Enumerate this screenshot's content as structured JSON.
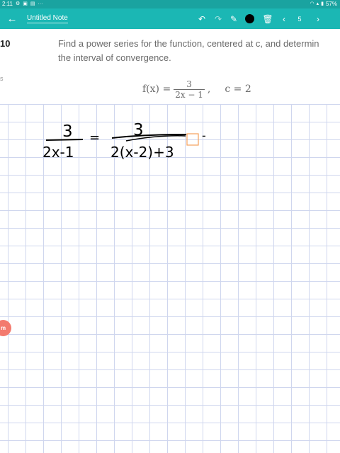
{
  "status_bar": {
    "time": "2:11",
    "battery": "57%",
    "icons": [
      "settings-icon",
      "image-icon",
      "gallery-icon",
      "more-icon",
      "wifi-icon",
      "signal-icon",
      "battery-icon"
    ]
  },
  "toolbar": {
    "title": "Untitled Note",
    "page_number": "5",
    "accent_color": "#1bb7b4",
    "pen_color": "#000000",
    "icons": [
      "back-icon",
      "undo-icon",
      "redo-icon",
      "pen-icon",
      "color-icon",
      "delete-icon",
      "prev-page-icon",
      "next-page-icon"
    ]
  },
  "problem": {
    "number": "10",
    "side_label": "s",
    "text_line1": "Find a power series for the function, centered at c, and determin",
    "text_line2": "the interval of convergence.",
    "formula_lhs": "f(x) =",
    "formula_num": "3",
    "formula_den": "2x − 1",
    "formula_comma": ",",
    "formula_c": "c = 2"
  },
  "handwriting": {
    "lhs_num": "3",
    "lhs_den": "2x-1",
    "equals": "=",
    "rhs_num": "3",
    "rhs_den": "2(x-2)+3",
    "trailing": "-",
    "ink_color": "#000000",
    "selection_color": "#f5a05a"
  },
  "badge": {
    "label": "m",
    "color": "#f37a6e"
  }
}
